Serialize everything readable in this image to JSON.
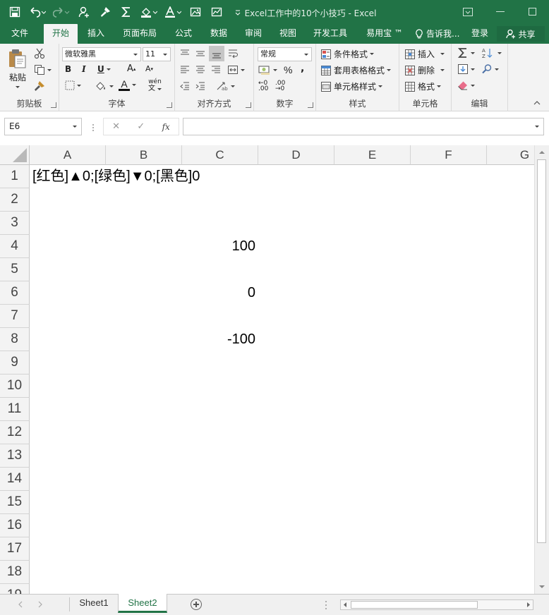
{
  "window": {
    "title": "Excel工作中的10个小技巧 - Excel"
  },
  "tabs": [
    {
      "label": "文件"
    },
    {
      "label": "开始"
    },
    {
      "label": "插入"
    },
    {
      "label": "页面布局"
    },
    {
      "label": "公式"
    },
    {
      "label": "数据"
    },
    {
      "label": "审阅"
    },
    {
      "label": "视图"
    },
    {
      "label": "开发工具"
    },
    {
      "label": "易用宝 ™"
    }
  ],
  "tellme": "告诉我...",
  "login": "登录",
  "share": "共享",
  "ribbon": {
    "clipboard": {
      "paste": "粘贴",
      "label": "剪贴板"
    },
    "font": {
      "name": "微软雅黑",
      "size": "11",
      "label": "字体"
    },
    "align": {
      "label": "对齐方式"
    },
    "number": {
      "format": "常规",
      "label": "数字"
    },
    "styles": {
      "conditional": "条件格式",
      "table": "套用表格格式",
      "cell": "单元格样式",
      "label": "样式"
    },
    "cells": {
      "insert": "插入",
      "delete": "删除",
      "format": "格式",
      "label": "单元格"
    },
    "editing": {
      "label": "编辑"
    }
  },
  "formula_bar": {
    "namebox": "E6",
    "formula": ""
  },
  "columns": [
    "A",
    "B",
    "C",
    "D",
    "E",
    "F",
    "G"
  ],
  "rows": [
    "1",
    "2",
    "3",
    "4",
    "5",
    "6",
    "7",
    "8",
    "9",
    "10",
    "11",
    "12",
    "13",
    "14",
    "15",
    "16",
    "17",
    "18",
    "19"
  ],
  "cells": {
    "A1": "[红色]▲0;[绿色]▼0;[黑色]0",
    "C4": "100",
    "C6": "0",
    "C8": "-100"
  },
  "sheets": [
    {
      "name": "Sheet1"
    },
    {
      "name": "Sheet2"
    }
  ],
  "colors": {
    "excel_green": "#217346",
    "ribbon_bg": "#f3f3f3"
  }
}
